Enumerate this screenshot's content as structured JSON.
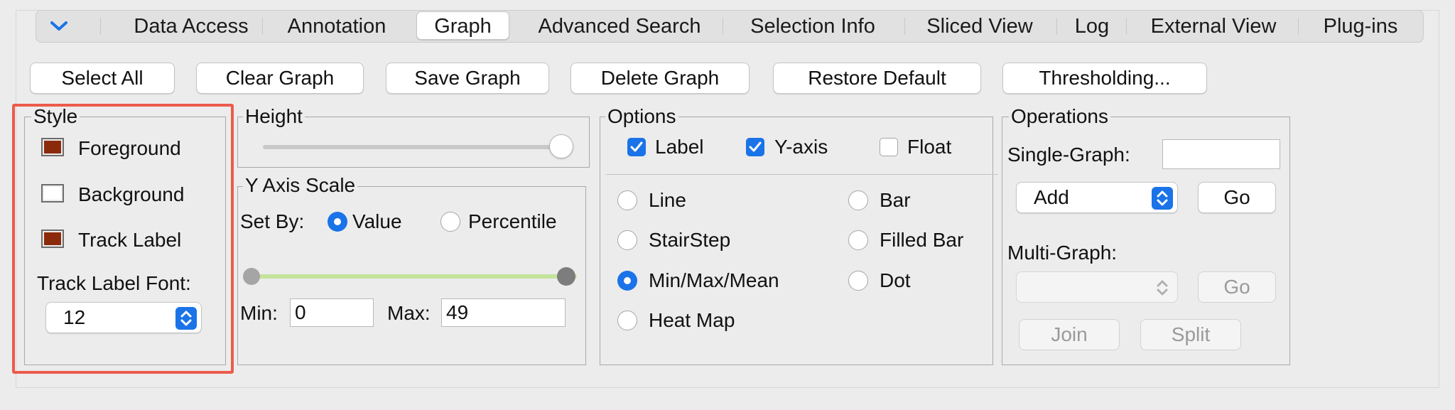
{
  "tabs": [
    {
      "label": "Data Access"
    },
    {
      "label": "Annotation"
    },
    {
      "label": "Graph"
    },
    {
      "label": "Advanced Search"
    },
    {
      "label": "Selection Info"
    },
    {
      "label": "Sliced View"
    },
    {
      "label": "Log"
    },
    {
      "label": "External View"
    },
    {
      "label": "Plug-ins"
    }
  ],
  "active_tab": "Graph",
  "toolbar": {
    "select_all": "Select All",
    "clear_graph": "Clear Graph",
    "save_graph": "Save Graph",
    "delete_graph": "Delete Graph",
    "restore_default": "Restore Default",
    "thresholding": "Thresholding..."
  },
  "style": {
    "title": "Style",
    "foreground": {
      "label": "Foreground",
      "color": "#8b2a0b"
    },
    "background": {
      "label": "Background",
      "color": "#ffffff"
    },
    "track_label": {
      "label": "Track Label",
      "color": "#8b2a0b"
    },
    "font_label": "Track Label Font:",
    "font_size": "12"
  },
  "height": {
    "title": "Height",
    "slider_value": 1.0
  },
  "y_axis_scale": {
    "title": "Y Axis Scale",
    "set_by_label": "Set By:",
    "value_label": "Value",
    "percentile_label": "Percentile",
    "selected": "Value",
    "range_min_fraction": 0.0,
    "range_max_fraction": 1.0,
    "min_label": "Min:",
    "min_value": "0",
    "max_label": "Max:",
    "max_value": "49"
  },
  "options": {
    "title": "Options",
    "label_check": {
      "label": "Label",
      "checked": true
    },
    "yaxis_check": {
      "label": "Y-axis",
      "checked": true
    },
    "float_check": {
      "label": "Float",
      "checked": false
    },
    "graph_types": [
      "Line",
      "StairStep",
      "Min/Max/Mean",
      "Heat Map",
      "Bar",
      "Filled Bar",
      "Dot"
    ],
    "selected_type": "Min/Max/Mean"
  },
  "operations": {
    "title": "Operations",
    "single_label": "Single-Graph:",
    "single_value": "",
    "single_op": "Add",
    "go": "Go",
    "multi_label": "Multi-Graph:",
    "multi_op": "",
    "join": "Join",
    "split": "Split"
  },
  "colors": {
    "accent": "#1a73e8",
    "highlight": "#ec5b4c",
    "slider_track": "#c4e39b"
  }
}
